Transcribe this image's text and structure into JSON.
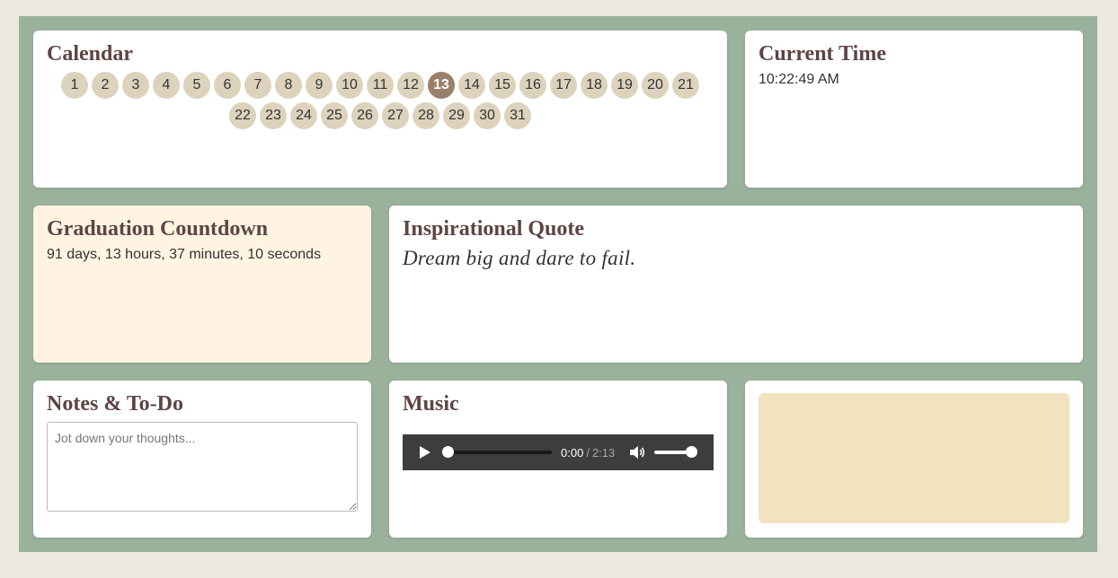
{
  "calendar": {
    "title": "Calendar",
    "days": [
      "1",
      "2",
      "3",
      "4",
      "5",
      "6",
      "7",
      "8",
      "9",
      "10",
      "11",
      "12",
      "13",
      "14",
      "15",
      "16",
      "17",
      "18",
      "19",
      "20",
      "21",
      "22",
      "23",
      "24",
      "25",
      "26",
      "27",
      "28",
      "29",
      "30",
      "31"
    ],
    "today": "13"
  },
  "time": {
    "title": "Current Time",
    "value": "10:22:49 AM"
  },
  "graduation": {
    "title": "Graduation Countdown",
    "value": "91 days, 13 hours, 37 minutes, 10 seconds"
  },
  "quote": {
    "title": "Inspirational Quote",
    "text": "Dream big and dare to fail."
  },
  "notes": {
    "title": "Notes & To-Do",
    "placeholder": "Jot down your thoughts..."
  },
  "music": {
    "title": "Music",
    "current": "0:00",
    "separator": "/",
    "duration": "2:13",
    "progress": 0,
    "volume": 1
  },
  "colors": {
    "board": "#9ab29b",
    "page": "#ece8df",
    "heading": "#5e4444",
    "day": "#ddd3bd",
    "today": "#9a7f6b",
    "countdown_bg": "#fff4e2",
    "image_placeholder": "#f1e3c0"
  }
}
